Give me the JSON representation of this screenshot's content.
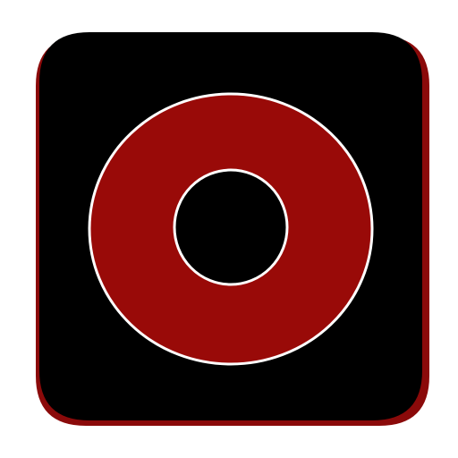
{
  "app_icon": {
    "icon_name": "record-ring-icon",
    "colors": {
      "background": "#ffffff",
      "tile_shadow": "#8b0a0a",
      "tile": "#000000",
      "ring": "#990a08",
      "outline": "#ffffff",
      "center": "#000000"
    }
  }
}
